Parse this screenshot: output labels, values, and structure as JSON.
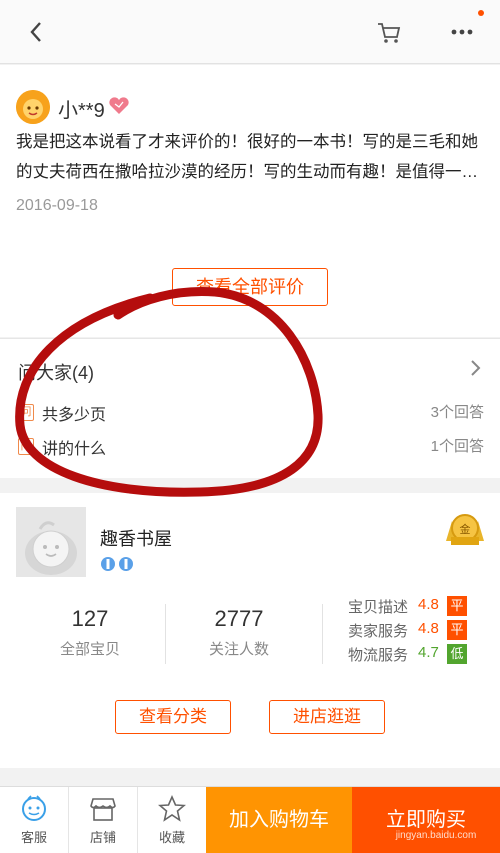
{
  "review": {
    "username": "小**9",
    "text": "我是把这本说看了才来评价的！很好的一本书！写的是三毛和她的丈夫荷西在撒哈拉沙漠的经历！写的生动而有趣！是值得一…",
    "date": "2016-09-18",
    "view_all_label": "查看全部评价"
  },
  "ask": {
    "title": "问大家(4)",
    "questions": [
      {
        "text": "共多少页",
        "answers": "3个回答"
      },
      {
        "text": "讲的什么",
        "answers": "1个回答"
      }
    ]
  },
  "shop": {
    "name": "趣香书屋",
    "medal_label": "金",
    "stats": [
      {
        "value": "127",
        "label": "全部宝贝"
      },
      {
        "value": "2777",
        "label": "关注人数"
      }
    ],
    "scores": [
      {
        "label": "宝贝描述",
        "value": "4.8",
        "tag": "平"
      },
      {
        "label": "卖家服务",
        "value": "4.8",
        "tag": "平"
      },
      {
        "label": "物流服务",
        "value": "4.7",
        "tag": "低"
      }
    ],
    "category_label": "查看分类",
    "visit_label": "进店逛逛"
  },
  "bottom": {
    "tabs": [
      {
        "label": "客服",
        "icon": "customer-service-icon"
      },
      {
        "label": "店铺",
        "icon": "store-icon"
      },
      {
        "label": "收藏",
        "icon": "star-icon"
      }
    ],
    "add_cart_label": "加入购物车",
    "buy_label": "立即购买"
  },
  "watermark": {
    "text": "jingyan.baidu.com"
  },
  "colors": {
    "accent": "#ff5000",
    "cart": "#ff9402",
    "green": "#52a52e",
    "circle": "#b50d0d"
  }
}
